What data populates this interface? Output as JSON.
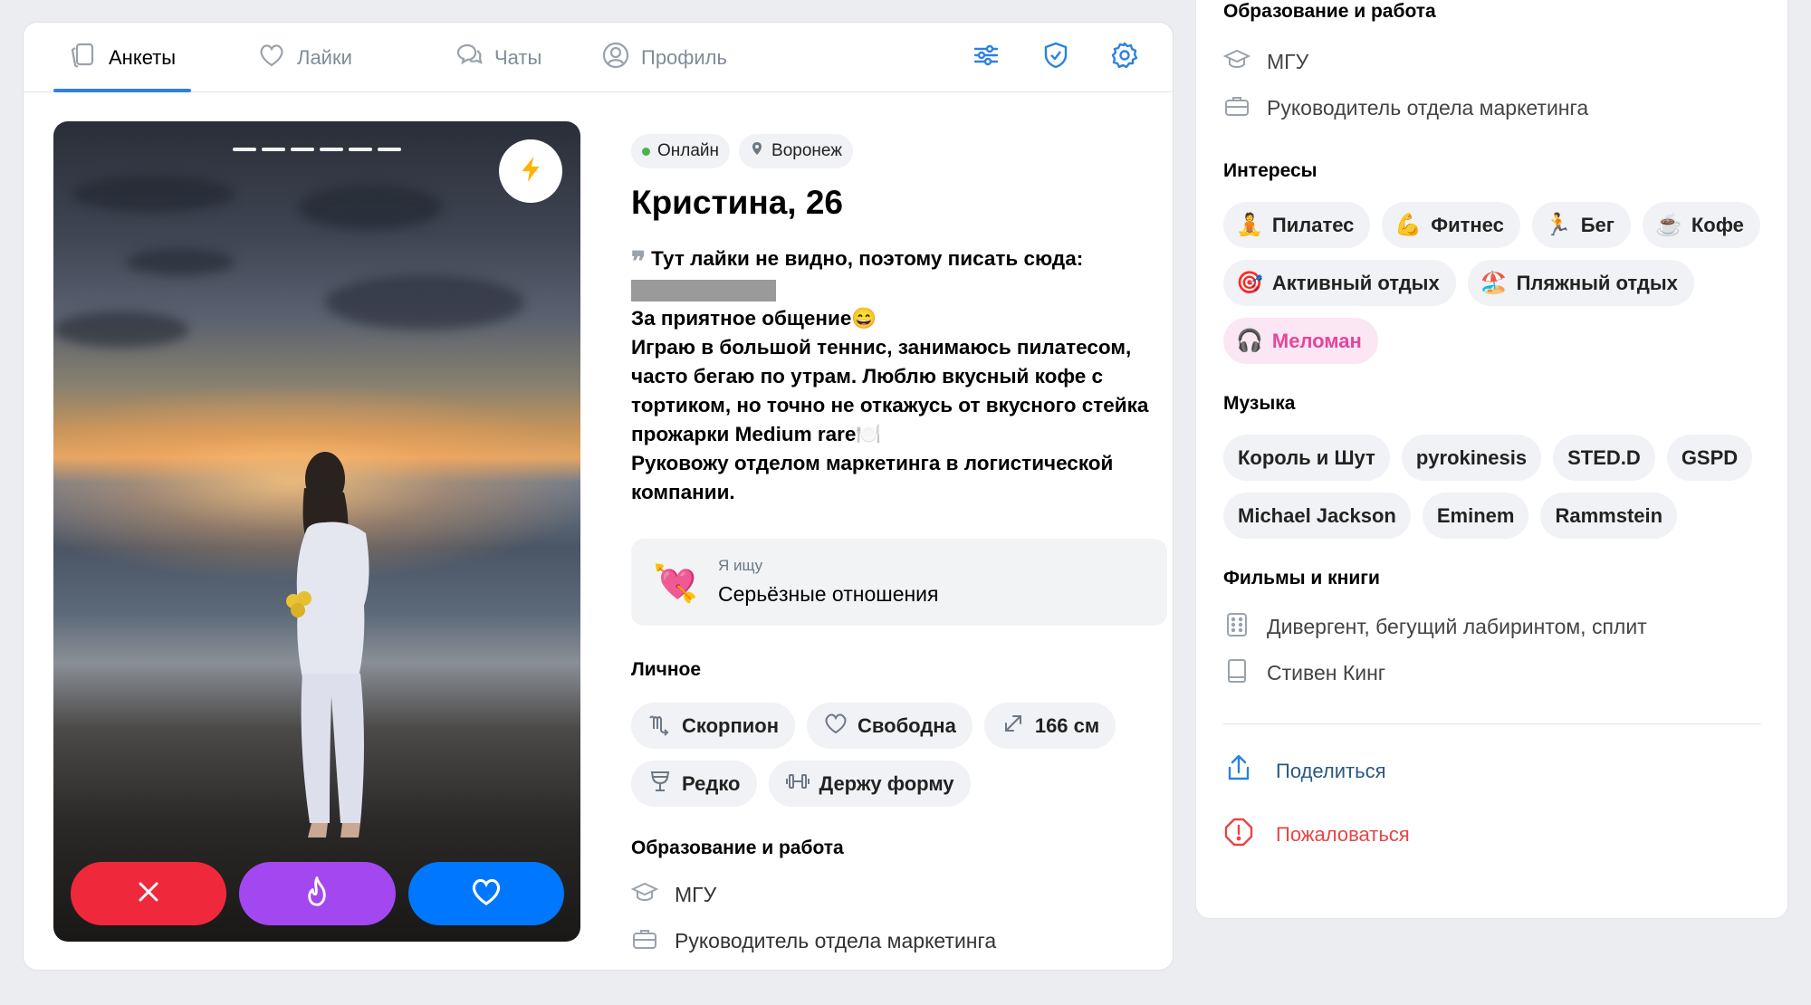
{
  "tabs": [
    {
      "label": "Анкеты",
      "icon": "cards-icon",
      "active": true
    },
    {
      "label": "Лайки",
      "icon": "heart-icon"
    },
    {
      "label": "Чаты",
      "icon": "chats-icon"
    },
    {
      "label": "Профиль",
      "icon": "profile-icon"
    }
  ],
  "tools": [
    "filters-icon",
    "shield-check-icon",
    "settings-icon"
  ],
  "photo": {
    "boost_icon": "lightning-icon",
    "progress_segments": 6
  },
  "actions": [
    "dislike-icon",
    "superlike-fire-icon",
    "like-heart-icon"
  ],
  "profile": {
    "status": "Онлайн",
    "city": "Воронеж",
    "name_age": "Кристина, 26",
    "quote": "Тут лайки не видно, поэтому писать сюда:",
    "bio": [
      "За приятное общение😄",
      "Играю в большой теннис, занимаюсь пилатесом, часто бегаю по утрам. Люблю вкусный кофе с тортиком, но точно не откажусь от вкусного стейка прожарки Medium rare🍽️",
      "Руковожу отделом маркетинга в логистической компании."
    ],
    "seek_label": "Я ищу",
    "seek_value": "Серьёзные отношения",
    "seek_emoji": "💘"
  },
  "personal": {
    "title": "Личное",
    "items": [
      {
        "label": "Скорпион",
        "icon": "scorpio-icon"
      },
      {
        "label": "Свободна",
        "icon": "heart-outline-icon"
      },
      {
        "label": "166 см",
        "icon": "height-arrows-icon"
      },
      {
        "label": "Редко",
        "icon": "wine-glass-icon"
      },
      {
        "label": "Держу форму",
        "icon": "dumbbell-icon"
      }
    ]
  },
  "education": {
    "title": "Образование и работа",
    "university": "МГУ",
    "job": "Руководитель отдела маркетинга"
  },
  "interests": {
    "title": "Интересы",
    "items": [
      {
        "emoji": "🧘",
        "label": "Пилатес"
      },
      {
        "emoji": "💪",
        "label": "Фитнес"
      },
      {
        "emoji": "🏃",
        "label": "Бег"
      },
      {
        "emoji": "☕",
        "label": "Кофе"
      },
      {
        "emoji": "🎯",
        "label": "Активный отдых"
      },
      {
        "emoji": "🏖️",
        "label": "Пляжный отдых"
      },
      {
        "emoji": "🎧",
        "label": "Меломан",
        "highlight": true
      }
    ]
  },
  "music": {
    "title": "Музыка",
    "items": [
      "Король и Шут",
      "pyrokinesis",
      "STED.D",
      "GSPD",
      "Michael Jackson",
      "Eminem",
      "Rammstein"
    ]
  },
  "films": {
    "title": "Фильмы и книги",
    "films": "Дивергент, бегущий лабиринтом, сплит",
    "books": "Стивен Кинг"
  },
  "links": {
    "share": "Поделиться",
    "report": "Пожаловаться"
  },
  "colors": {
    "accent": "#2d81e0",
    "dislike": "#f0283c",
    "superlike": "#a347f0",
    "like": "#0077ff",
    "report": "#e64646",
    "link": "#2a5885"
  }
}
